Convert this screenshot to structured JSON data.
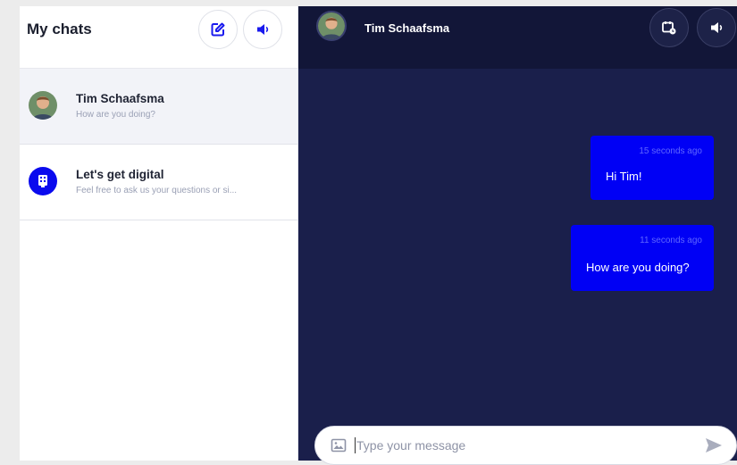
{
  "sidebar": {
    "title": "My chats",
    "conversations": [
      {
        "name": "Tim Schaafsma",
        "preview": "How are you doing?",
        "icon": "user-avatar"
      },
      {
        "name": "Let's get digital",
        "preview": "Feel free to ask us your questions or si...",
        "icon": "digital-logo"
      }
    ]
  },
  "chat": {
    "title": "Tim Schaafsma",
    "messages": [
      {
        "time": "15 seconds ago",
        "text": "Hi Tim!"
      },
      {
        "time": "11 seconds ago",
        "text": "How are you doing?"
      }
    ],
    "composer": {
      "placeholder": "Type your message"
    }
  },
  "colors": {
    "chat_bg": "#1a1f4b",
    "header_bg": "#121638",
    "bubble": "#0000f5",
    "accent": "#0a0aee"
  },
  "icons": [
    "compose-icon",
    "speaker-icon",
    "calendar-icon",
    "image-icon",
    "send-icon"
  ]
}
